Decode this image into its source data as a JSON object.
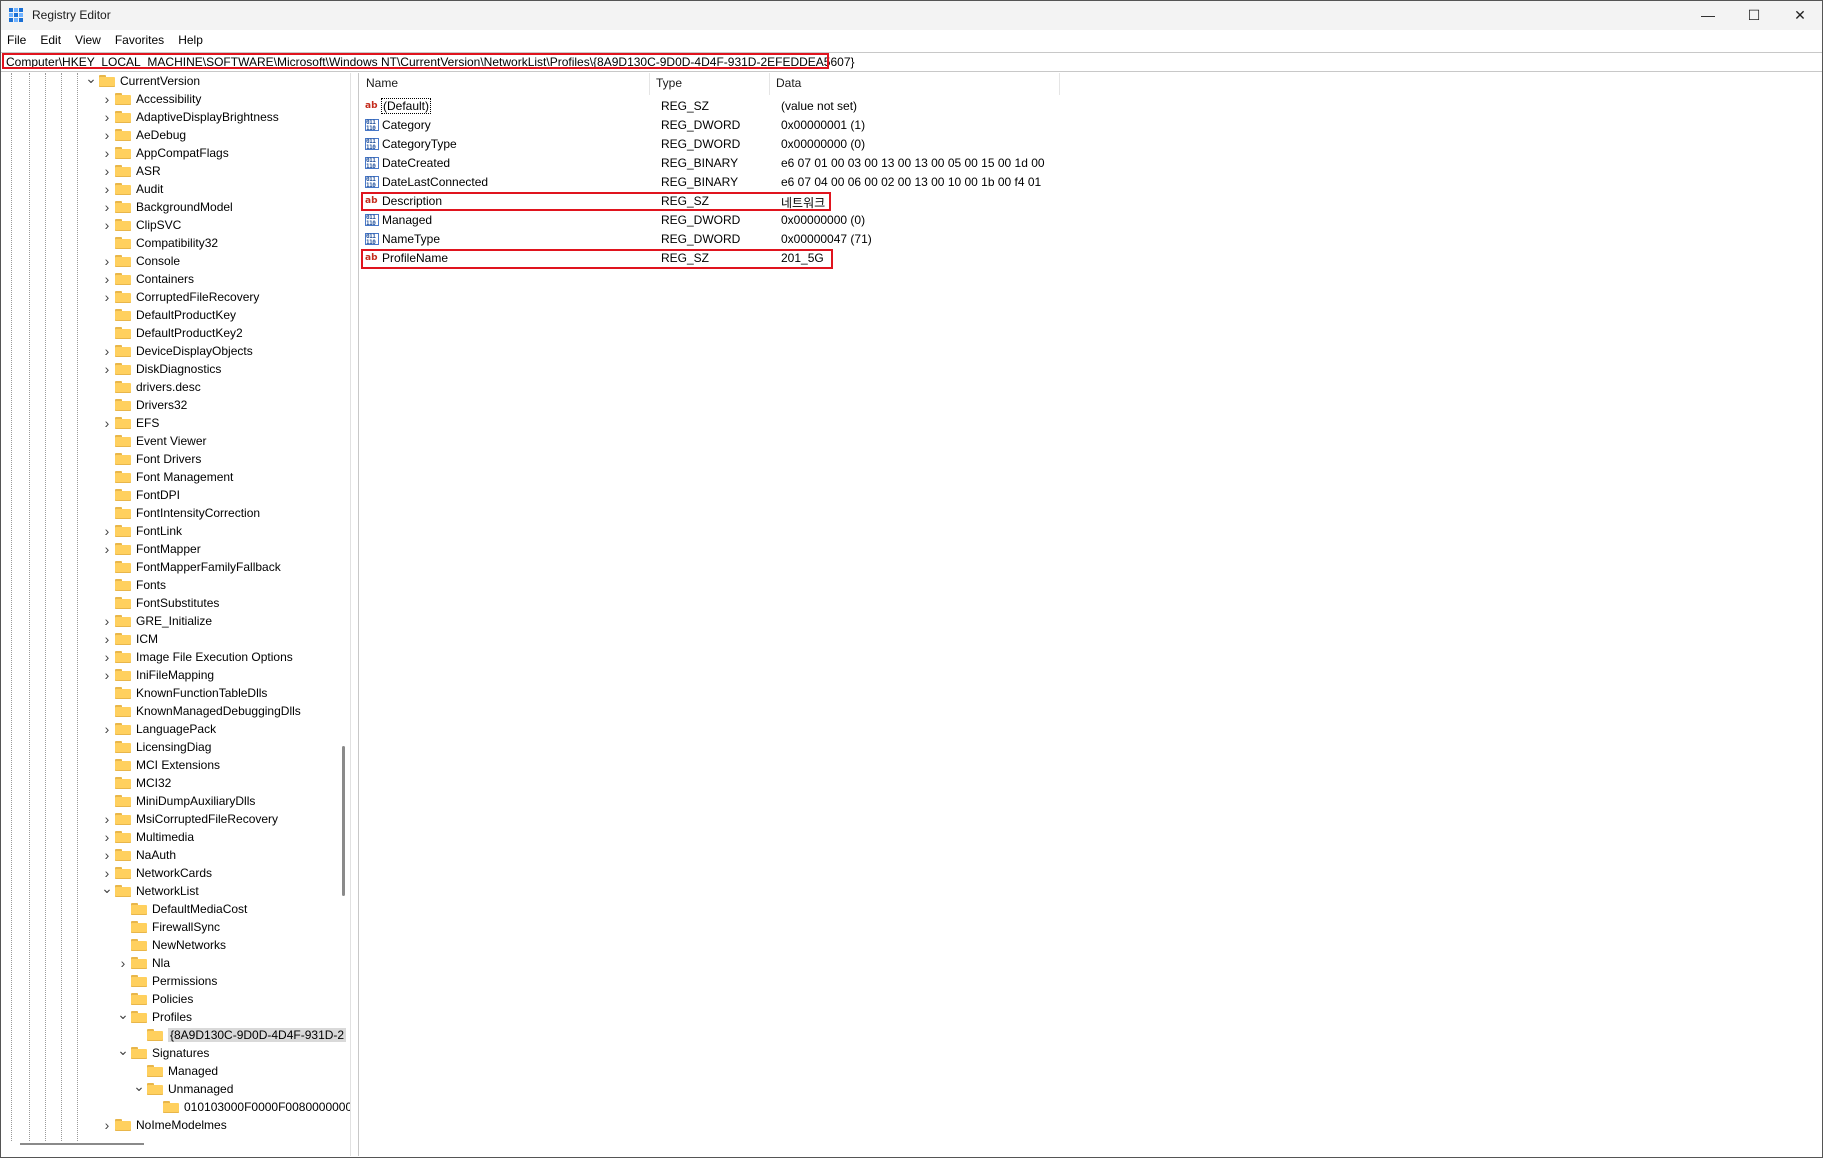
{
  "window": {
    "title": "Registry Editor",
    "controls": {
      "minimize": "—",
      "maximize": "☐",
      "close": "✕"
    }
  },
  "menu": [
    "File",
    "Edit",
    "View",
    "Favorites",
    "Help"
  ],
  "address": "Computer\\HKEY_LOCAL_MACHINE\\SOFTWARE\\Microsoft\\Windows NT\\CurrentVersion\\NetworkList\\Profiles\\{8A9D130C-9D0D-4D4F-931D-2EFEDDEA5607}",
  "tree": {
    "items": [
      {
        "label": "CurrentVersion",
        "depth": 0,
        "arrow": "v"
      },
      {
        "label": "Accessibility",
        "depth": 1,
        "arrow": ">"
      },
      {
        "label": "AdaptiveDisplayBrightness",
        "depth": 1,
        "arrow": ">"
      },
      {
        "label": "AeDebug",
        "depth": 1,
        "arrow": ">"
      },
      {
        "label": "AppCompatFlags",
        "depth": 1,
        "arrow": ">"
      },
      {
        "label": "ASR",
        "depth": 1,
        "arrow": ">"
      },
      {
        "label": "Audit",
        "depth": 1,
        "arrow": ">"
      },
      {
        "label": "BackgroundModel",
        "depth": 1,
        "arrow": ">"
      },
      {
        "label": "ClipSVC",
        "depth": 1,
        "arrow": ">"
      },
      {
        "label": "Compatibility32",
        "depth": 1,
        "arrow": ""
      },
      {
        "label": "Console",
        "depth": 1,
        "arrow": ">"
      },
      {
        "label": "Containers",
        "depth": 1,
        "arrow": ">"
      },
      {
        "label": "CorruptedFileRecovery",
        "depth": 1,
        "arrow": ">"
      },
      {
        "label": "DefaultProductKey",
        "depth": 1,
        "arrow": ""
      },
      {
        "label": "DefaultProductKey2",
        "depth": 1,
        "arrow": ""
      },
      {
        "label": "DeviceDisplayObjects",
        "depth": 1,
        "arrow": ">"
      },
      {
        "label": "DiskDiagnostics",
        "depth": 1,
        "arrow": ">"
      },
      {
        "label": "drivers.desc",
        "depth": 1,
        "arrow": ""
      },
      {
        "label": "Drivers32",
        "depth": 1,
        "arrow": ""
      },
      {
        "label": "EFS",
        "depth": 1,
        "arrow": ">"
      },
      {
        "label": "Event Viewer",
        "depth": 1,
        "arrow": ""
      },
      {
        "label": "Font Drivers",
        "depth": 1,
        "arrow": ""
      },
      {
        "label": "Font Management",
        "depth": 1,
        "arrow": ""
      },
      {
        "label": "FontDPI",
        "depth": 1,
        "arrow": ""
      },
      {
        "label": "FontIntensityCorrection",
        "depth": 1,
        "arrow": ""
      },
      {
        "label": "FontLink",
        "depth": 1,
        "arrow": ">"
      },
      {
        "label": "FontMapper",
        "depth": 1,
        "arrow": ">"
      },
      {
        "label": "FontMapperFamilyFallback",
        "depth": 1,
        "arrow": ""
      },
      {
        "label": "Fonts",
        "depth": 1,
        "arrow": ""
      },
      {
        "label": "FontSubstitutes",
        "depth": 1,
        "arrow": ""
      },
      {
        "label": "GRE_Initialize",
        "depth": 1,
        "arrow": ">"
      },
      {
        "label": "ICM",
        "depth": 1,
        "arrow": ">"
      },
      {
        "label": "Image File Execution Options",
        "depth": 1,
        "arrow": ">"
      },
      {
        "label": "IniFileMapping",
        "depth": 1,
        "arrow": ">"
      },
      {
        "label": "KnownFunctionTableDlls",
        "depth": 1,
        "arrow": ""
      },
      {
        "label": "KnownManagedDebuggingDlls",
        "depth": 1,
        "arrow": ""
      },
      {
        "label": "LanguagePack",
        "depth": 1,
        "arrow": ">"
      },
      {
        "label": "LicensingDiag",
        "depth": 1,
        "arrow": ""
      },
      {
        "label": "MCI Extensions",
        "depth": 1,
        "arrow": ""
      },
      {
        "label": "MCI32",
        "depth": 1,
        "arrow": ""
      },
      {
        "label": "MiniDumpAuxiliaryDlls",
        "depth": 1,
        "arrow": ""
      },
      {
        "label": "MsiCorruptedFileRecovery",
        "depth": 1,
        "arrow": ">"
      },
      {
        "label": "Multimedia",
        "depth": 1,
        "arrow": ">"
      },
      {
        "label": "NaAuth",
        "depth": 1,
        "arrow": ">"
      },
      {
        "label": "NetworkCards",
        "depth": 1,
        "arrow": ">"
      },
      {
        "label": "NetworkList",
        "depth": 1,
        "arrow": "v"
      },
      {
        "label": "DefaultMediaCost",
        "depth": 2,
        "arrow": ""
      },
      {
        "label": "FirewallSync",
        "depth": 2,
        "arrow": ""
      },
      {
        "label": "NewNetworks",
        "depth": 2,
        "arrow": ""
      },
      {
        "label": "Nla",
        "depth": 2,
        "arrow": ">"
      },
      {
        "label": "Permissions",
        "depth": 2,
        "arrow": ""
      },
      {
        "label": "Policies",
        "depth": 2,
        "arrow": ""
      },
      {
        "label": "Profiles",
        "depth": 2,
        "arrow": "v"
      },
      {
        "label": "{8A9D130C-9D0D-4D4F-931D-2",
        "depth": 3,
        "arrow": "",
        "selected": true
      },
      {
        "label": "Signatures",
        "depth": 2,
        "arrow": "v"
      },
      {
        "label": "Managed",
        "depth": 3,
        "arrow": ""
      },
      {
        "label": "Unmanaged",
        "depth": 3,
        "arrow": "v"
      },
      {
        "label": "010103000F0000F0080000000",
        "depth": 4,
        "arrow": ""
      },
      {
        "label": "NoImeModelmes",
        "depth": 1,
        "arrow": ">"
      }
    ]
  },
  "values": {
    "columns": {
      "name": "Name",
      "type": "Type",
      "data": "Data"
    },
    "rows": [
      {
        "icon": "string-value-icon",
        "name": "(Default)",
        "type": "REG_SZ",
        "data": "(value not set)",
        "focused": true
      },
      {
        "icon": "binary-value-icon",
        "name": "Category",
        "type": "REG_DWORD",
        "data": "0x00000001 (1)"
      },
      {
        "icon": "binary-value-icon",
        "name": "CategoryType",
        "type": "REG_DWORD",
        "data": "0x00000000 (0)"
      },
      {
        "icon": "binary-value-icon",
        "name": "DateCreated",
        "type": "REG_BINARY",
        "data": "e6 07 01 00 03 00 13 00 13 00 05 00 15 00 1d 00"
      },
      {
        "icon": "binary-value-icon",
        "name": "DateLastConnected",
        "type": "REG_BINARY",
        "data": "e6 07 04 00 06 00 02 00 13 00 10 00 1b 00 f4 01"
      },
      {
        "icon": "string-value-icon",
        "name": "Description",
        "type": "REG_SZ",
        "data": "네트워크",
        "highlighted": true
      },
      {
        "icon": "binary-value-icon",
        "name": "Managed",
        "type": "REG_DWORD",
        "data": "0x00000000 (0)"
      },
      {
        "icon": "binary-value-icon",
        "name": "NameType",
        "type": "REG_DWORD",
        "data": "0x00000047 (71)"
      },
      {
        "icon": "string-value-icon",
        "name": "ProfileName",
        "type": "REG_SZ",
        "data": "201_5G",
        "highlighted": true
      }
    ]
  },
  "colors": {
    "highlight": "#e0141e",
    "folder": "#ffd05e",
    "accent": "#1a6fd4"
  }
}
